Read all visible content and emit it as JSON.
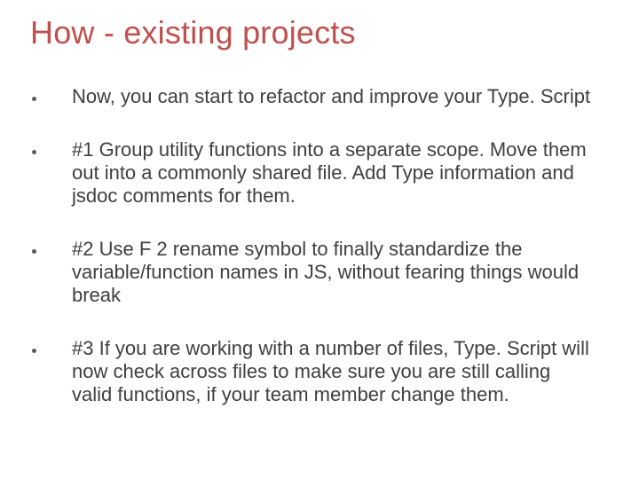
{
  "title": "How - existing projects",
  "bullets": [
    {
      "text": "Now, you can start to refactor and improve your Type. Script"
    },
    {
      "text": "#1 Group utility functions into a separate scope.\nMove them out into a commonly shared file.  Add Type information and jsdoc comments for them."
    },
    {
      "text": "#2 Use F 2 rename symbol to finally standardize the variable/function names in JS, without fearing things would break"
    },
    {
      "text": "#3 If you are working with a number of files, Type. Script will now check across files to make sure you are still calling valid functions, if your team member change them."
    }
  ]
}
